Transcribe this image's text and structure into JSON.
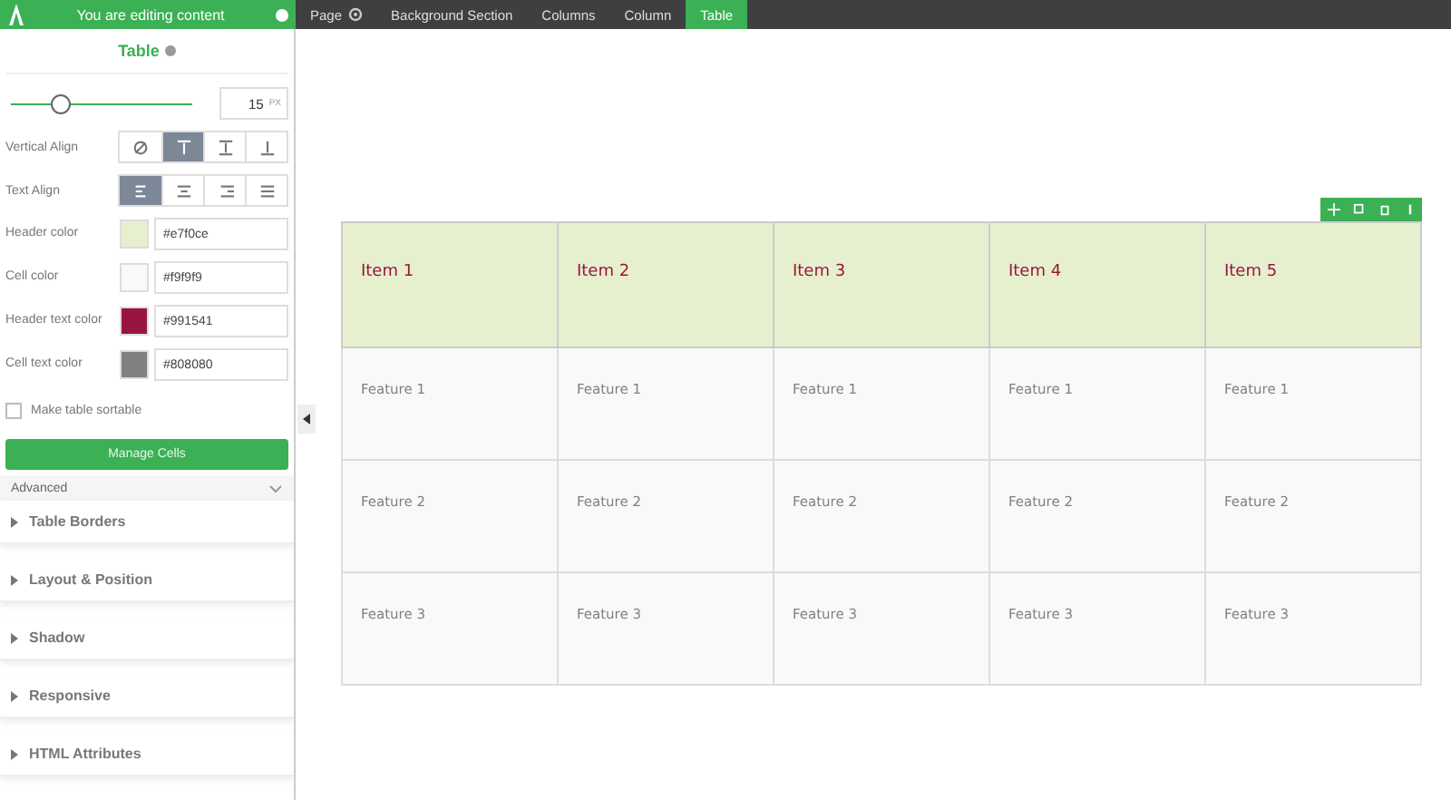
{
  "topbar": {
    "banner": "You are editing content",
    "breadcrumbs": [
      {
        "label": "Page",
        "selected": false
      },
      {
        "label": "Background Section",
        "selected": false
      },
      {
        "label": "Columns",
        "selected": false
      },
      {
        "label": "Column",
        "selected": false
      },
      {
        "label": "Table",
        "selected": true
      }
    ]
  },
  "panel": {
    "title": "Table",
    "slider": {
      "level": 0.27,
      "value": "15",
      "unit": "PX"
    },
    "vertical_align": {
      "label": "Vertical Align",
      "options": [
        {
          "selected": false
        },
        {
          "selected": true
        },
        {
          "selected": false
        },
        {
          "selected": false
        }
      ]
    },
    "text_align": {
      "label": "Text Align",
      "options": [
        {
          "selected": true
        },
        {
          "selected": false
        },
        {
          "selected": false
        },
        {
          "selected": false
        }
      ]
    },
    "colors": [
      {
        "label": "Header color",
        "value": "#e7f0ce",
        "color": "#e7f0ce"
      },
      {
        "label": "Cell color",
        "value": "#f9f9f9",
        "color": "#f9f9f9"
      },
      {
        "label": "Header text color",
        "value": "#991541",
        "color": "#991541"
      },
      {
        "label": "Cell text color",
        "value": "#808080",
        "color": "#808080"
      }
    ],
    "sortable": {
      "label": "Make table sortable",
      "checked": false
    },
    "manage_button": "Manage Cells",
    "advanced": "Advanced",
    "sections": [
      "Table Borders",
      "Layout & Position",
      "Shadow",
      "Responsive",
      "HTML Attributes"
    ]
  },
  "table": {
    "columns": [
      "Item 1",
      "Item 2",
      "Item 3",
      "Item 4",
      "Item 5"
    ],
    "rows": [
      [
        "Feature 1",
        "Feature 1",
        "Feature 1",
        "Feature 1",
        "Feature 1"
      ],
      [
        "Feature 2",
        "Feature 2",
        "Feature 2",
        "Feature 2",
        "Feature 2"
      ],
      [
        "Feature 3",
        "Feature 3",
        "Feature 3",
        "Feature 3",
        "Feature 3"
      ]
    ]
  }
}
